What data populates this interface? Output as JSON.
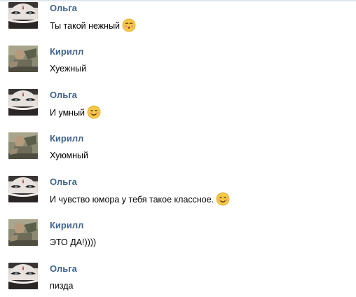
{
  "messages": [
    {
      "author": "Ольга",
      "text": "Ты такой нежный",
      "emoji": "kissing-face-icon",
      "avatar": "olga"
    },
    {
      "author": "Кирилл",
      "text": "Хуежный",
      "emoji": null,
      "avatar": "kirill"
    },
    {
      "author": "Ольга",
      "text": "И умный",
      "emoji": "smiling-face-icon",
      "avatar": "olga"
    },
    {
      "author": "Кирилл",
      "text": "Хуюмный",
      "emoji": null,
      "avatar": "kirill"
    },
    {
      "author": "Ольга",
      "text": "И чувство юмора у тебя такое классное.",
      "emoji": "smiling-face-icon",
      "avatar": "olga"
    },
    {
      "author": "Кирилл",
      "text": "ЭТО ДА!))))",
      "emoji": null,
      "avatar": "kirill"
    },
    {
      "author": "Ольга",
      "text": "пизда",
      "emoji": null,
      "avatar": "olga"
    }
  ],
  "colors": {
    "author_name": "#42648b",
    "message_text": "#000000",
    "background": "#ffffff"
  }
}
